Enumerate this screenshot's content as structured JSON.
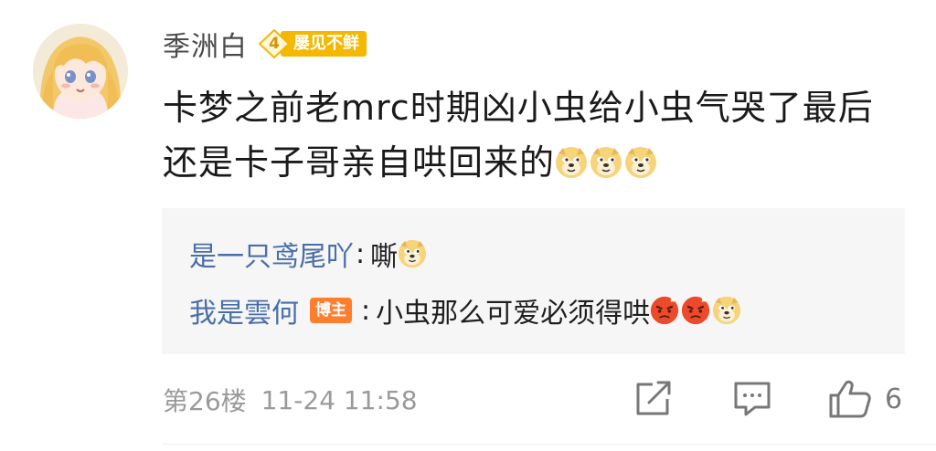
{
  "user": {
    "name": "季洲白",
    "level": "4",
    "level_title": "屡见不鲜"
  },
  "comment": {
    "line1": "卡梦之前老mrc时期凶小虫给小虫气哭了最后",
    "line2": "还是卡子哥亲自哄回来的"
  },
  "replies": [
    {
      "name": "是一只鸢尾吖",
      "separator": ":",
      "text": "嘶"
    },
    {
      "name": "我是雲何",
      "badge": "博主",
      "separator": ":",
      "text": "小虫那么可爱必须得哄"
    }
  ],
  "footer": {
    "floor": "第26楼",
    "time": "11-24 11:58",
    "like_count": "6"
  },
  "icons": [
    "share-icon",
    "comment-icon",
    "like-icon",
    "doge-emoji",
    "angry-emoji"
  ],
  "colors": {
    "reply_name": "#4a6fa8",
    "level_badge": "#f5b800",
    "host_badge": "#ff7e2e",
    "reply_bg": "#f6f6f6"
  }
}
